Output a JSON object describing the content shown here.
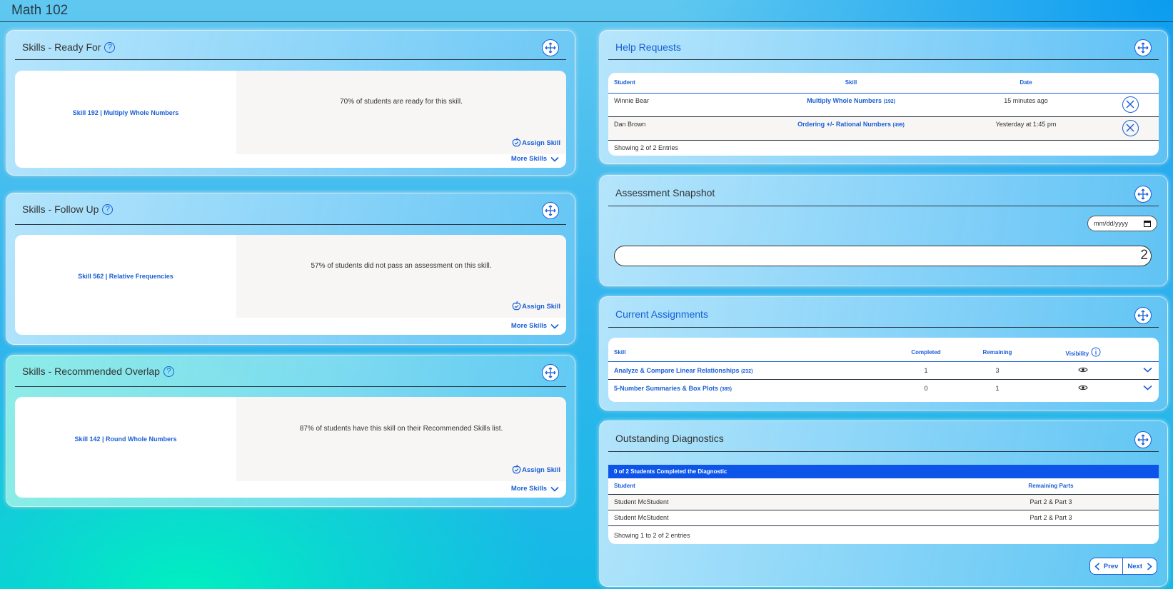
{
  "app": {
    "title": "Math 102"
  },
  "ready_for": {
    "title": "Skills - Ready For",
    "skill_link": "Skill 192 | Multiply Whole Numbers",
    "message": "70% of students are ready for this skill.",
    "assign_label": "Assign Skill",
    "more_label": "More Skills"
  },
  "follow_up": {
    "title": "Skills - Follow Up",
    "skill_link": "Skill 562 | Relative Frequencies",
    "message": "57% of students did not pass an assessment on this skill.",
    "assign_label": "Assign Skill",
    "more_label": "More Skills"
  },
  "overlap": {
    "title": "Skills - Recommended Overlap",
    "skill_link": "Skill 142 | Round Whole Numbers",
    "message": "87% of students have this skill on their Recommended Skills list.",
    "assign_label": "Assign Skill",
    "more_label": "More Skills"
  },
  "help_requests": {
    "title": "Help Requests",
    "columns": [
      "Student",
      "Skill",
      "Date"
    ],
    "rows": [
      {
        "student": "Winnie Bear",
        "skill": "Multiply Whole Numbers",
        "skill_num": "(192)",
        "date": "15 minutes ago"
      },
      {
        "student": "Dan Brown",
        "skill": "Ordering +/- Rational Numbers",
        "skill_num": "(499)",
        "date": "Yesterday at 1:45 pm"
      }
    ],
    "footer": "Showing 2 of 2 Entries"
  },
  "assessment": {
    "title": "Assessment Snapshot",
    "date_placeholder": "mm/dd/yyyy",
    "bar_value": "2"
  },
  "assignments": {
    "title": "Current Assignments",
    "columns": [
      "Skill",
      "Completed",
      "Remaining",
      "Visibility"
    ],
    "rows": [
      {
        "skill": "Analyze & Compare Linear Relationships",
        "skill_num": "(232)",
        "completed": "1",
        "remaining": "3"
      },
      {
        "skill": "5-Number Summaries & Box Plots",
        "skill_num": "(385)",
        "completed": "0",
        "remaining": "1"
      }
    ]
  },
  "diagnostics": {
    "title": "Outstanding Diagnostics",
    "banner": "0 of 2 Students Completed the Diagnostic",
    "columns": [
      "Student",
      "Remaining Parts"
    ],
    "rows": [
      {
        "student": "Student McStudent",
        "parts": "Part 2 & Part 3"
      },
      {
        "student": "Student McStudent",
        "parts": "Part 2 & Part 3"
      }
    ],
    "footer": "Showing 1 to 2 of 2 entries",
    "prev_label": "Prev",
    "next_label": "Next"
  },
  "colors": {
    "accent": "#1a5fd6",
    "banner": "#0d55e8"
  }
}
